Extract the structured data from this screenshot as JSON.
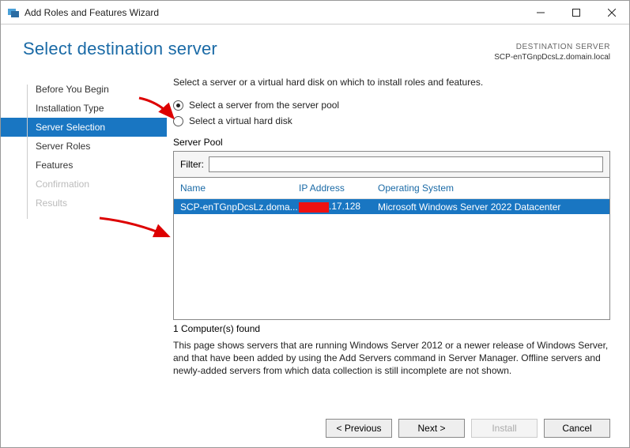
{
  "window": {
    "title": "Add Roles and Features Wizard"
  },
  "header": {
    "page_title": "Select destination server",
    "dest_label": "DESTINATION SERVER",
    "dest_value": "SCP-enTGnpDcsLz.domain.local"
  },
  "sidebar": {
    "items": [
      {
        "label": "Before You Begin",
        "state": "normal"
      },
      {
        "label": "Installation Type",
        "state": "normal"
      },
      {
        "label": "Server Selection",
        "state": "active"
      },
      {
        "label": "Server Roles",
        "state": "normal"
      },
      {
        "label": "Features",
        "state": "normal"
      },
      {
        "label": "Confirmation",
        "state": "disabled"
      },
      {
        "label": "Results",
        "state": "disabled"
      }
    ]
  },
  "content": {
    "instruction": "Select a server or a virtual hard disk on which to install roles and features.",
    "radio1": "Select a server from the server pool",
    "radio2": "Select a virtual hard disk",
    "radio_selected": 0,
    "pool_label": "Server Pool",
    "filter_label": "Filter:",
    "filter_value": "",
    "columns": {
      "name": "Name",
      "ip": "IP Address",
      "os": "Operating System"
    },
    "rows": [
      {
        "name": "SCP-enTGnpDcsLz.doma...",
        "ip_suffix": ".17.128",
        "os": "Microsoft Windows Server 2022 Datacenter",
        "selected": true
      }
    ],
    "count_text": "1 Computer(s) found",
    "explain": "This page shows servers that are running Windows Server 2012 or a newer release of Windows Server, and that have been added by using the Add Servers command in Server Manager. Offline servers and newly-added servers from which data collection is still incomplete are not shown."
  },
  "footer": {
    "previous": "< Previous",
    "next": "Next >",
    "install": "Install",
    "cancel": "Cancel"
  }
}
